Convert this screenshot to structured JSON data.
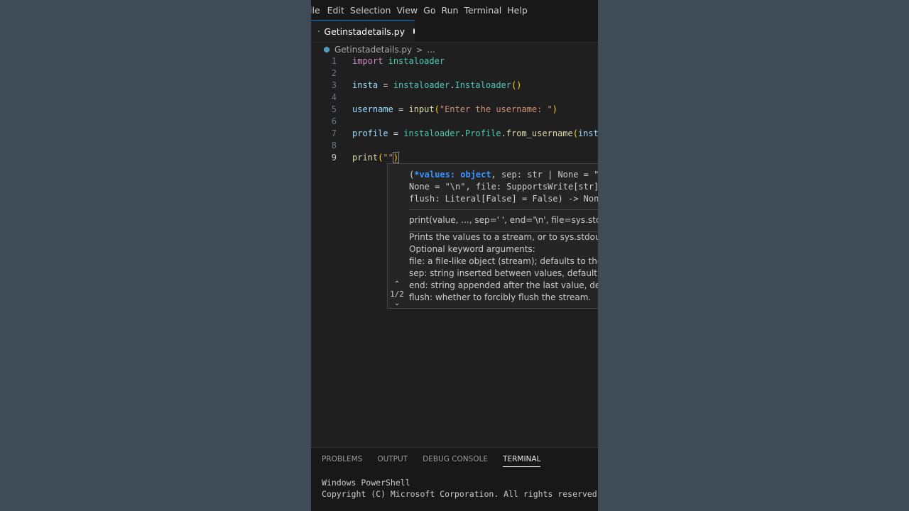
{
  "menu": [
    "ile",
    "Edit",
    "Selection",
    "View",
    "Go",
    "Run",
    "Terminal",
    "Help"
  ],
  "tab": {
    "filename": "Getinstadetails.py"
  },
  "breadcrumb": {
    "file": "Getinstadetails.py",
    "sep": ">",
    "more": "..."
  },
  "code": {
    "lines": [
      {
        "num": "1",
        "tokens": [
          {
            "t": "import",
            "c": "kw"
          },
          {
            "t": " ",
            "c": "op"
          },
          {
            "t": "instaloader",
            "c": "mod"
          }
        ]
      },
      {
        "num": "2",
        "tokens": []
      },
      {
        "num": "3",
        "tokens": [
          {
            "t": "insta",
            "c": "var"
          },
          {
            "t": " = ",
            "c": "op"
          },
          {
            "t": "instaloader",
            "c": "mod"
          },
          {
            "t": ".",
            "c": "op"
          },
          {
            "t": "Instaloader",
            "c": "mod"
          },
          {
            "t": "()",
            "c": "paren"
          }
        ]
      },
      {
        "num": "4",
        "tokens": []
      },
      {
        "num": "5",
        "tokens": [
          {
            "t": "username",
            "c": "var"
          },
          {
            "t": " = ",
            "c": "op"
          },
          {
            "t": "input",
            "c": "fn"
          },
          {
            "t": "(",
            "c": "paren"
          },
          {
            "t": "\"Enter the username: \"",
            "c": "str"
          },
          {
            "t": ")",
            "c": "paren"
          }
        ]
      },
      {
        "num": "6",
        "tokens": []
      },
      {
        "num": "7",
        "tokens": [
          {
            "t": "profile",
            "c": "var"
          },
          {
            "t": " = ",
            "c": "op"
          },
          {
            "t": "instaloader",
            "c": "mod"
          },
          {
            "t": ".",
            "c": "op"
          },
          {
            "t": "Profile",
            "c": "mod"
          },
          {
            "t": ".",
            "c": "op"
          },
          {
            "t": "from_username",
            "c": "fn"
          },
          {
            "t": "(",
            "c": "paren"
          },
          {
            "t": "insta.",
            "c": "var"
          }
        ]
      },
      {
        "num": "8",
        "tokens": []
      },
      {
        "num": "9",
        "tokens": [
          {
            "t": "print",
            "c": "fn"
          },
          {
            "t": "(",
            "c": "paren"
          },
          {
            "t": "\"\"",
            "c": "str"
          },
          {
            "t": ")",
            "c": "paren cursor-bracket"
          }
        ]
      }
    ]
  },
  "hover": {
    "sig_line1_pre": "(",
    "sig_active": "*values: object",
    "sig_line1_post": ", sep: str | None = \" \"",
    "sig_line2": "None = \"\\n\", file: SupportsWrite[str] |",
    "sig_line3": "flush: Literal[False] = False) -> None",
    "code": "print(value, ..., sep=' ', end='\\n', file=sys.stdout, f",
    "doc": "Prints the values to a stream, or to sys.stdout by\nOptional keyword arguments:\nfile: a file-like object (stream); defaults to the cur\nsep: string inserted between values, default a sp\nend: string appended after the last value, default\nflush: whether to forcibly flush the stream.",
    "pager": "1/2"
  },
  "panel": {
    "tabs": [
      "PROBLEMS",
      "OUTPUT",
      "DEBUG CONSOLE",
      "TERMINAL"
    ],
    "active_tab": "TERMINAL",
    "terminal": "Windows PowerShell\nCopyright (C) Microsoft Corporation. All rights reserved."
  },
  "colors": {
    "accent": "#0078d4",
    "background": "#3f4b57",
    "editor": "#1f1f1f"
  },
  "icons": {
    "file": "python-icon",
    "modified": "unsaved-dot-icon",
    "prev": "chevron-up-icon",
    "next": "chevron-down-icon"
  }
}
